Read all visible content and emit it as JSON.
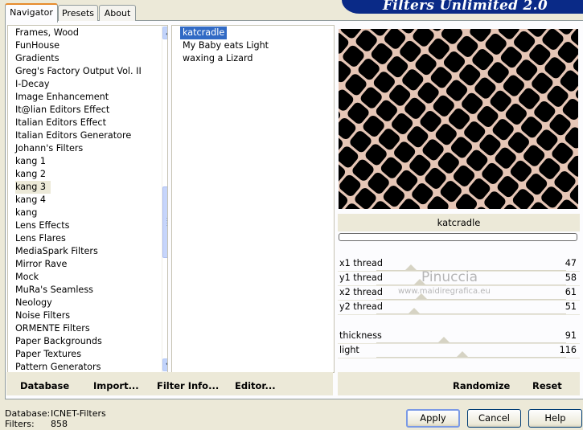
{
  "header": {
    "title": "Filters Unlimited 2.0"
  },
  "tabs": [
    {
      "label": "Navigator"
    },
    {
      "label": "Presets"
    },
    {
      "label": "About"
    }
  ],
  "categories": {
    "items": [
      "Frames, Wood",
      "FunHouse",
      "Gradients",
      "Greg's Factory Output Vol. II",
      "I-Decay",
      "Image Enhancement",
      "It@lian Editors Effect",
      "Italian Editors Effect",
      "Italian Editors Generatore",
      "Johann's Filters",
      "kang 1",
      "kang 2",
      "kang 3",
      "kang 4",
      "kang",
      "Lens Effects",
      "Lens Flares",
      "MediaSpark Filters",
      "Mirror Rave",
      "Mock",
      "MuRa's Seamless",
      "Neology",
      "Noise Filters",
      "ORMENTE Filters",
      "Paper Backgrounds",
      "Paper Textures",
      "Pattern Generators"
    ],
    "selected": "kang 3"
  },
  "filters": {
    "items": [
      "katcradle",
      "My Baby eats Light",
      "waxing a Lizard"
    ],
    "selected": "katcradle"
  },
  "toolbar": {
    "database": "Database",
    "import": "Import...",
    "filter_info": "Filter Info...",
    "editor": "Editor..."
  },
  "preview": {
    "caption": "katcradle"
  },
  "sliders": [
    {
      "label": "x1 thread",
      "value": 47
    },
    {
      "label": "y1 thread",
      "value": 58
    },
    {
      "label": "x2 thread",
      "value": 61
    },
    {
      "label": "y2 thread",
      "value": 51
    },
    {
      "label": "thickness",
      "value": 91
    },
    {
      "label": "light",
      "value": 116
    }
  ],
  "watermark": {
    "name": "Pinuccia",
    "site": "www.maidiregrafica.eu"
  },
  "actions": {
    "randomize": "Randomize",
    "reset": "Reset"
  },
  "status": {
    "database_label": "Database:",
    "database_value": "ICNET-Filters",
    "filters_label": "Filters:",
    "filters_value": "858"
  },
  "buttons": {
    "apply": "Apply",
    "cancel": "Cancel",
    "help": "Help"
  },
  "colors": {
    "accent_tab": "#e68b2c",
    "selection": "#316ac5",
    "banner": "#0a2a87"
  }
}
